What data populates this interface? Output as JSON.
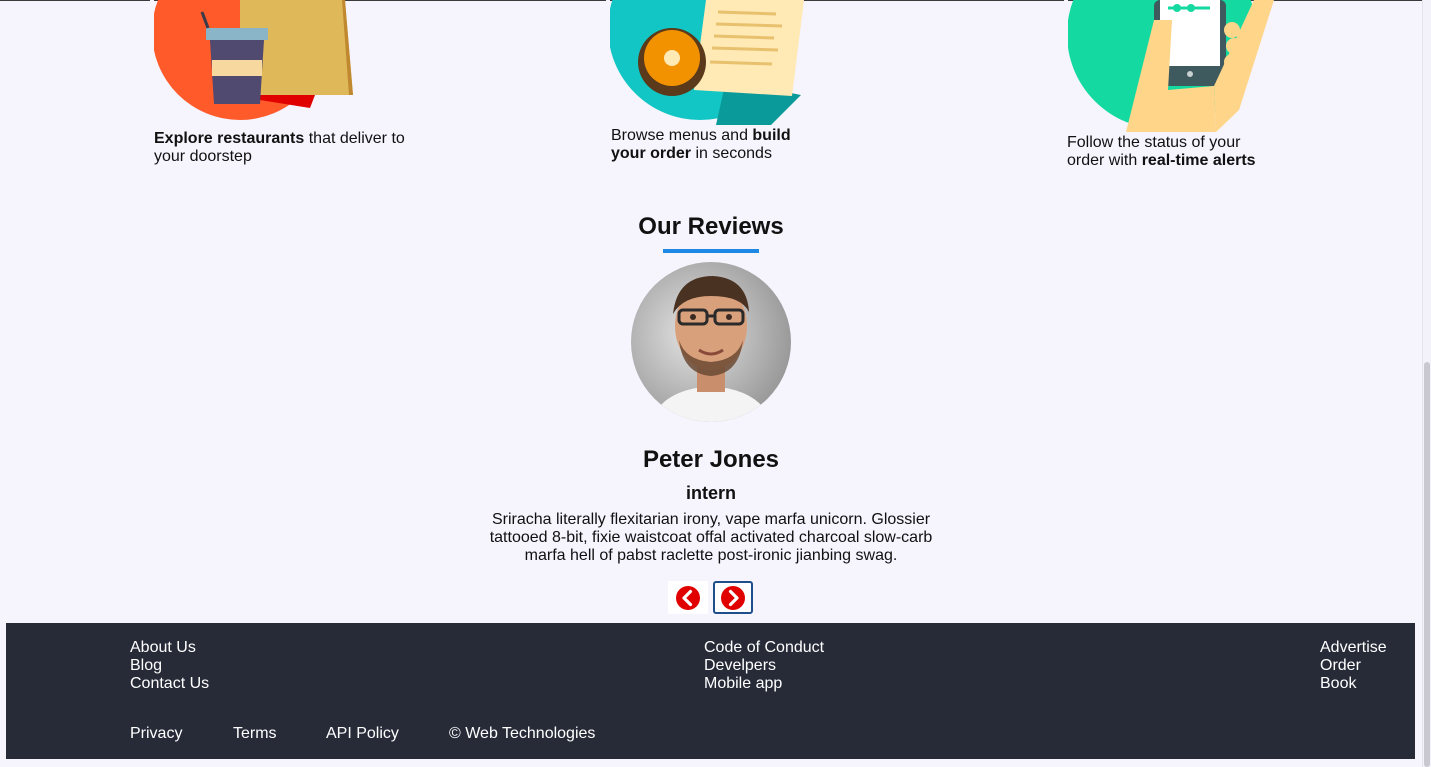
{
  "features": [
    {
      "bold": "Explore restaurants",
      "text": " that deliver to your doorstep",
      "icon": "restaurant-bag-cup-icon"
    },
    {
      "pre": "Browse menus and ",
      "bold": "build your order",
      "text": " in seconds",
      "icon": "menu-donut-icon"
    },
    {
      "pre": "Follow the status of your order with ",
      "bold": "real-time alerts",
      "icon": "phone-hand-icon"
    }
  ],
  "reviews": {
    "title": "Our Reviews",
    "name": "Peter Jones",
    "role": "intern",
    "text": "Sriracha literally flexitarian irony, vape marfa unicorn. Glossier tattooed 8-bit, fixie waistcoat offal activated charcoal slow-carb marfa hell of pabst raclette post-ironic jianbing swag.",
    "accent": "#1e88e5",
    "arrow_color": "#e00000"
  },
  "footer": {
    "col1": [
      "About Us",
      "Blog",
      "Contact Us"
    ],
    "col2": [
      "Code of Conduct",
      "Develpers",
      "Mobile app"
    ],
    "col3": [
      "Advertise",
      "Order",
      "Book"
    ],
    "bottom": [
      "Privacy",
      "Terms",
      "API Policy",
      "© Web Technologies"
    ],
    "bg": "#272b38"
  }
}
